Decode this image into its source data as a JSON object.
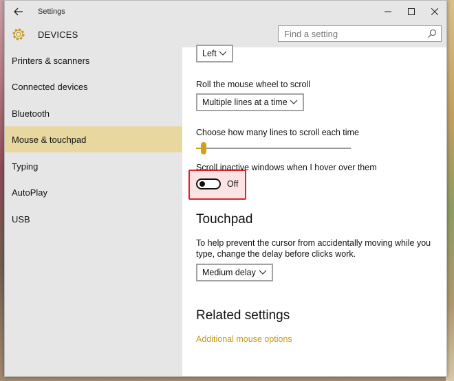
{
  "window": {
    "title": "Settings",
    "controls": {
      "minimize": "—",
      "maximize": "☐",
      "close": "✕"
    }
  },
  "header": {
    "section_title": "DEVICES",
    "search_placeholder": "Find a setting"
  },
  "sidebar": {
    "items": [
      {
        "label": "Printers & scanners",
        "active": false
      },
      {
        "label": "Connected devices",
        "active": false
      },
      {
        "label": "Bluetooth",
        "active": false
      },
      {
        "label": "Mouse & touchpad",
        "active": true
      },
      {
        "label": "Typing",
        "active": false
      },
      {
        "label": "AutoPlay",
        "active": false
      },
      {
        "label": "USB",
        "active": false
      }
    ]
  },
  "main": {
    "primary_button_select": "Left",
    "scroll_label": "Roll the mouse wheel to scroll",
    "scroll_select": "Multiple lines at a time",
    "lines_label": "Choose how many lines to scroll each time",
    "lines_slider_fraction": 0.05,
    "inactive_label": "Scroll inactive windows when I hover over them",
    "inactive_toggle_state": "Off",
    "touchpad_heading": "Touchpad",
    "touchpad_description": "To help prevent the cursor from accidentally moving while you type, change the delay before clicks work.",
    "delay_select": "Medium delay",
    "related_heading": "Related settings",
    "related_link": "Additional mouse options"
  },
  "colors": {
    "accent": "#d39f1e",
    "link": "#c49a1a",
    "active_nav": "#e8d8a0",
    "highlight_border": "#e0202a"
  }
}
